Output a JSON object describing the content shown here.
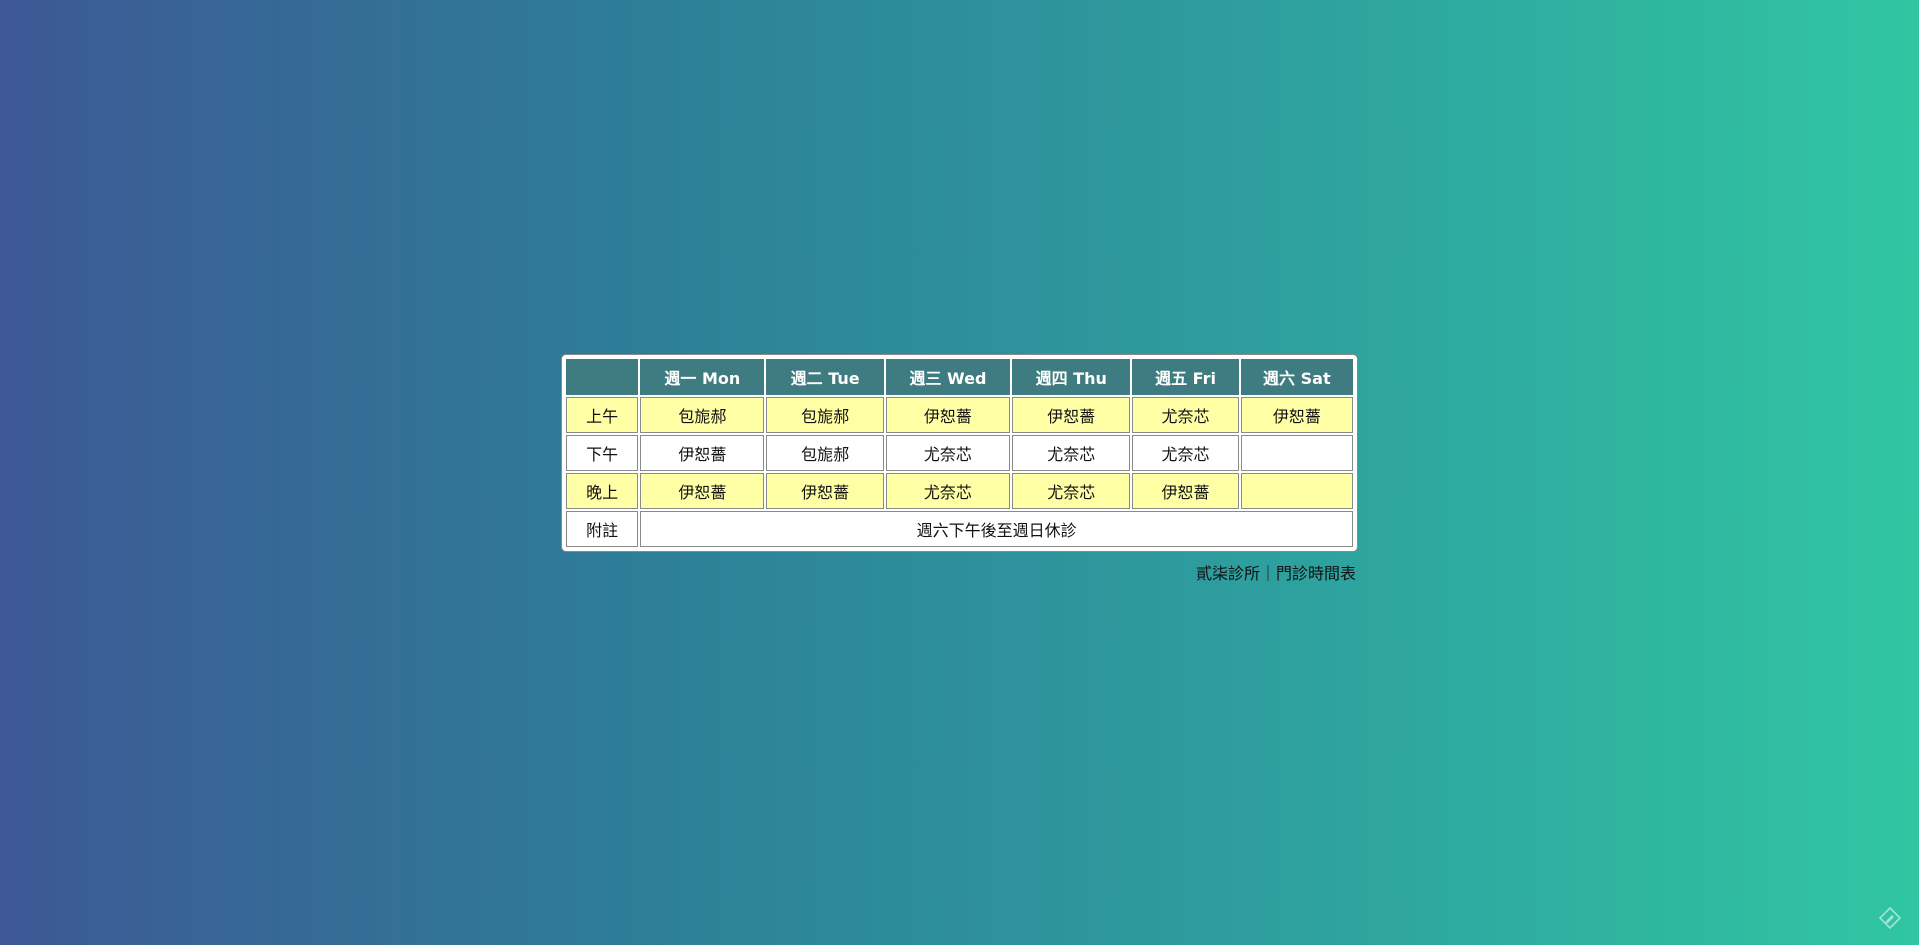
{
  "schedule": {
    "headers": [
      "",
      "週一 Mon",
      "週二 Tue",
      "週三 Wed",
      "週四 Thu",
      "週五 Fri",
      "週六 Sat"
    ],
    "rows": [
      {
        "label": "上午",
        "cells": [
          "包旎郝",
          "包旎郝",
          "伊恕薔",
          "伊恕薔",
          "尤奈芯",
          "伊恕薔"
        ]
      },
      {
        "label": "下午",
        "cells": [
          "伊恕薔",
          "包旎郝",
          "尤奈芯",
          "尤奈芯",
          "尤奈芯",
          ""
        ]
      },
      {
        "label": "晚上",
        "cells": [
          "伊恕薔",
          "伊恕薔",
          "尤奈芯",
          "尤奈芯",
          "伊恕薔",
          ""
        ]
      }
    ],
    "note": {
      "label": "附註",
      "text": "週六下午後至週日休診"
    }
  },
  "caption": "貳柒診所｜門診時間表",
  "colors": {
    "header_bg": "#3f7c81",
    "highlight_row_bg": "#ffffa6",
    "gradient_start": "#3d5895",
    "gradient_end": "#30c6a2"
  },
  "icons": {
    "corner": "pen-icon"
  }
}
